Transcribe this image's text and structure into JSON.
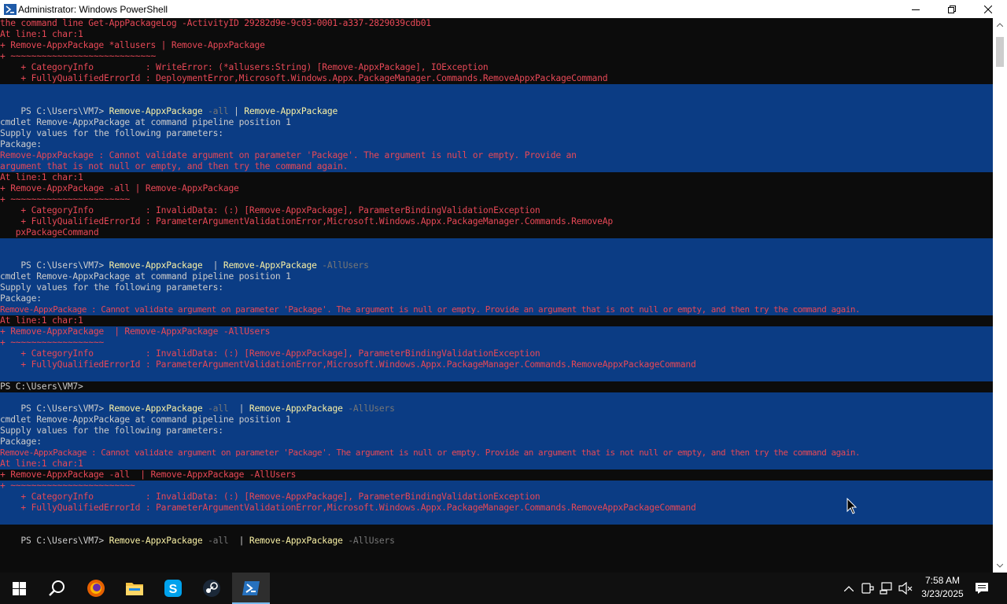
{
  "window": {
    "title": "Administrator: Windows PowerShell",
    "minimize_label": "Minimize",
    "maximize_label": "Restore",
    "close_label": "Close"
  },
  "console": {
    "line_01": "the command line Get-AppPackageLog -ActivityID 29282d9e-9c03-0001-a337-2829039cdb01",
    "line_02": "At line:1 char:1",
    "line_03": "+ Remove-AppxPackage *allusers | Remove-AppxPackage",
    "line_04": "+ ~~~~~~~~~~~~~~~~~~~~~~~~~~~~",
    "line_05": "    + CategoryInfo          : WriteError: (*allusers:String) [Remove-AppxPackage], IOException",
    "line_06": "    + FullyQualifiedErrorId : DeploymentError,Microsoft.Windows.Appx.PackageManager.Commands.RemoveAppxPackageCommand",
    "cmd1_prompt": "PS C:\\Users\\VM7> ",
    "cmd1_a": "Remove-AppxPackage",
    "cmd1_b": " -all ",
    "cmd1_c": "| ",
    "cmd1_d": "Remove-AppxPackage",
    "b1_l1": "cmdlet Remove-AppxPackage at command pipeline position 1",
    "b1_l2": "Supply values for the following parameters:",
    "b1_l3": "Package:",
    "b1_e1": "Remove-AppxPackage : Cannot validate argument on parameter 'Package'. The argument is null or empty. Provide an",
    "b1_e2": "argument that is not null or empty, and then try the command again.",
    "b1_e3": "At line:1 char:1",
    "b1_e4": "+ Remove-AppxPackage -all | Remove-AppxPackage",
    "b1_e5": "+ ~~~~~~~~~~~~~~~~~~~~~~~",
    "b1_e6": "    + CategoryInfo          : InvalidData: (:) [Remove-AppxPackage], ParameterBindingValidationException",
    "b1_e7": "    + FullyQualifiedErrorId : ParameterArgumentValidationError,Microsoft.Windows.Appx.PackageManager.Commands.RemoveAp",
    "b1_e8": "   pxPackageCommand",
    "cmd2_prompt": "PS C:\\Users\\VM7> ",
    "cmd2_a": "Remove-AppxPackage",
    "cmd2_b": "  | ",
    "cmd2_c": "Remove-AppxPackage",
    "cmd2_d": " -AllUsers",
    "b2_l1": "cmdlet Remove-AppxPackage at command pipeline position 1",
    "b2_l2": "Supply values for the following parameters:",
    "b2_l3": "Package:",
    "b2_e1": "Remove-AppxPackage : Cannot validate argument on parameter 'Package'. The argument is null or empty. Provide an argument that is not null or empty, and then try the command again.",
    "b2_e2": "At line:1 char:1",
    "b2_e3": "+ Remove-AppxPackage  | Remove-AppxPackage -AllUsers",
    "b2_e4": "+ ~~~~~~~~~~~~~~~~~~",
    "b2_e5": "    + CategoryInfo          : InvalidData: (:) [Remove-AppxPackage], ParameterBindingValidationException",
    "b2_e6": "    + FullyQualifiedErrorId : ParameterArgumentValidationError,Microsoft.Windows.Appx.PackageManager.Commands.RemoveAppxPackageCommand",
    "cmd3_prompt_only": "PS C:\\Users\\VM7>",
    "cmd4_prompt": "PS C:\\Users\\VM7> ",
    "cmd4_a": "Remove-AppxPackage",
    "cmd4_b": " -all",
    "cmd4_c": "  | ",
    "cmd4_d": "Remove-AppxPackage",
    "cmd4_e": " -AllUsers",
    "b3_l1": "cmdlet Remove-AppxPackage at command pipeline position 1",
    "b3_l2": "Supply values for the following parameters:",
    "b3_l3": "Package:",
    "b3_e1": "Remove-AppxPackage : Cannot validate argument on parameter 'Package'. The argument is null or empty. Provide an argument that is not null or empty, and then try the command again.",
    "b3_e2": "At line:1 char:1",
    "b3_e3": "+ Remove-AppxPackage -all  | Remove-AppxPackage -AllUsers",
    "b3_e4": "+ ~~~~~~~~~~~~~~~~~~~~~~~~",
    "b3_e5": "    + CategoryInfo          : InvalidData: (:) [Remove-AppxPackage], ParameterBindingValidationException",
    "b3_e6": "    + FullyQualifiedErrorId : ParameterArgumentValidationError,Microsoft.Windows.Appx.PackageManager.Commands.RemoveAppxPackageCommand",
    "cmd5_prompt": "PS C:\\Users\\VM7> ",
    "cmd5_a": "Remove-AppxPackage",
    "cmd5_b": " -all",
    "cmd5_c": "  | ",
    "cmd5_d": "Remove-AppxPackage",
    "cmd5_e": " -AllUsers"
  },
  "taskbar": {
    "apps": [
      "start-icon",
      "search-icon",
      "firefox-icon",
      "file-explorer-icon",
      "skype-icon",
      "steam-icon",
      "powershell-icon"
    ],
    "clock_time": "7:58 AM",
    "clock_date": "3/23/2025"
  },
  "colors": {
    "console_bg": "#0c0c0c",
    "selection": "#0b3c84",
    "command_yellow": "#f9f1a5",
    "error_red": "#e74856",
    "param_gray": "#767676"
  }
}
